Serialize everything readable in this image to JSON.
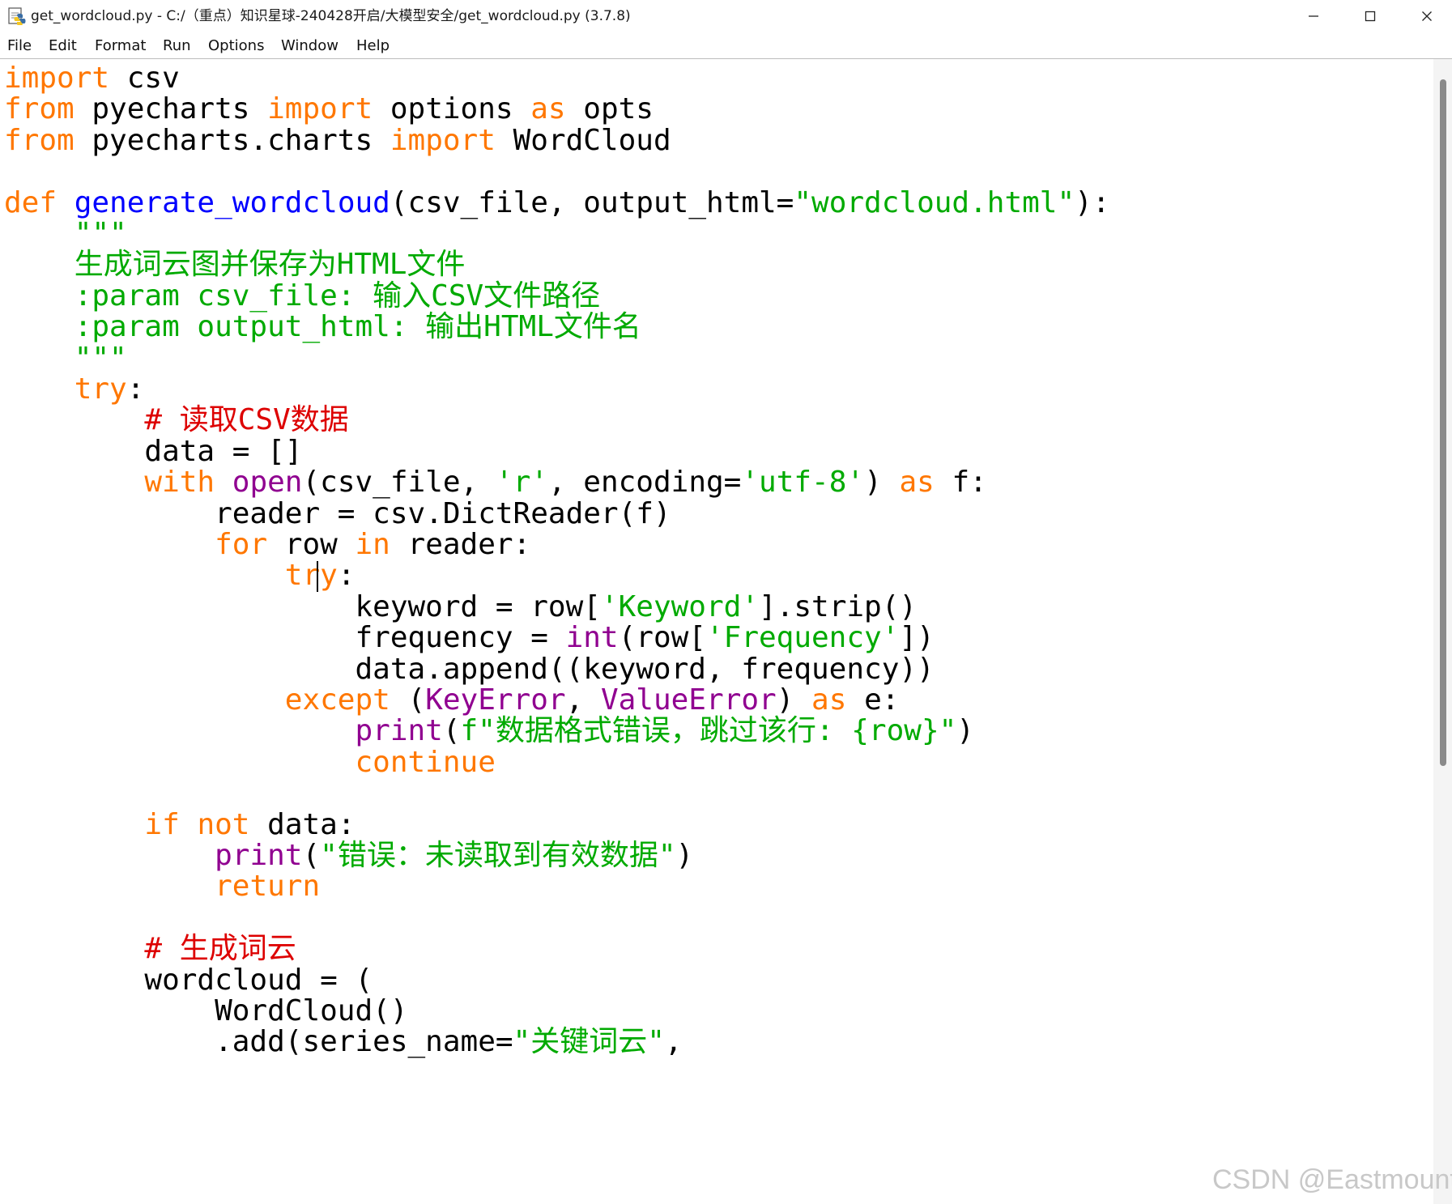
{
  "window": {
    "title": "get_wordcloud.py - C:/（重点）知识星球-240428开启/大模型安全/get_wordcloud.py (3.7.8)",
    "app_icon": "python-idle-icon",
    "controls": {
      "minimize": "─",
      "maximize": "☐",
      "close": "✕"
    }
  },
  "menu": {
    "items": [
      "File",
      "Edit",
      "Format",
      "Run",
      "Options",
      "Window",
      "Help"
    ]
  },
  "colors": {
    "keyword": "#ff7700",
    "builtin": "#900090",
    "string": "#00aa00",
    "comment": "#dd0000",
    "definition": "#0000ff",
    "text": "#000000"
  },
  "editor": {
    "lines": [
      [
        [
          "kw",
          "import"
        ],
        [
          "tx",
          " csv"
        ]
      ],
      [
        [
          "kw",
          "from"
        ],
        [
          "tx",
          " pyecharts "
        ],
        [
          "kw",
          "import"
        ],
        [
          "tx",
          " options "
        ],
        [
          "kw",
          "as"
        ],
        [
          "tx",
          " opts"
        ]
      ],
      [
        [
          "kw",
          "from"
        ],
        [
          "tx",
          " pyecharts.charts "
        ],
        [
          "kw",
          "import"
        ],
        [
          "tx",
          " WordCloud"
        ]
      ],
      [],
      [
        [
          "kw",
          "def"
        ],
        [
          "tx",
          " "
        ],
        [
          "df",
          "generate_wordcloud"
        ],
        [
          "tx",
          "(csv_file, output_html="
        ],
        [
          "st",
          "\"wordcloud.html\""
        ],
        [
          "tx",
          "):"
        ]
      ],
      [
        [
          "tx",
          "    "
        ],
        [
          "st",
          "\"\"\""
        ]
      ],
      [
        [
          "st",
          "    生成词云图并保存为HTML文件"
        ]
      ],
      [
        [
          "st",
          "    :param csv_file: 输入CSV文件路径"
        ]
      ],
      [
        [
          "st",
          "    :param output_html: 输出HTML文件名"
        ]
      ],
      [
        [
          "st",
          "    \"\"\""
        ]
      ],
      [
        [
          "tx",
          "    "
        ],
        [
          "kw",
          "try"
        ],
        [
          "tx",
          ":"
        ]
      ],
      [
        [
          "tx",
          "        "
        ],
        [
          "cm",
          "# 读取CSV数据"
        ]
      ],
      [
        [
          "tx",
          "        data = []"
        ]
      ],
      [
        [
          "tx",
          "        "
        ],
        [
          "kw",
          "with"
        ],
        [
          "tx",
          " "
        ],
        [
          "bi",
          "open"
        ],
        [
          "tx",
          "(csv_file, "
        ],
        [
          "st",
          "'r'"
        ],
        [
          "tx",
          ", encoding="
        ],
        [
          "st",
          "'utf-8'"
        ],
        [
          "tx",
          ") "
        ],
        [
          "kw",
          "as"
        ],
        [
          "tx",
          " f:"
        ]
      ],
      [
        [
          "tx",
          "            reader = csv.DictReader(f)"
        ]
      ],
      [
        [
          "tx",
          "            "
        ],
        [
          "kw",
          "for"
        ],
        [
          "tx",
          " row "
        ],
        [
          "kw",
          "in"
        ],
        [
          "tx",
          " reader:"
        ]
      ],
      [
        [
          "tx",
          "                "
        ],
        [
          "kw",
          "try"
        ],
        [
          "tx",
          ":"
        ]
      ],
      [
        [
          "tx",
          "                    keyword = row["
        ],
        [
          "st",
          "'Keyword'"
        ],
        [
          "tx",
          "].strip()"
        ]
      ],
      [
        [
          "tx",
          "                    frequency = "
        ],
        [
          "bi",
          "int"
        ],
        [
          "tx",
          "(row["
        ],
        [
          "st",
          "'Frequency'"
        ],
        [
          "tx",
          "])"
        ]
      ],
      [
        [
          "tx",
          "                    data.append((keyword, frequency))"
        ]
      ],
      [
        [
          "tx",
          "                "
        ],
        [
          "kw",
          "except"
        ],
        [
          "tx",
          " ("
        ],
        [
          "bi",
          "KeyError"
        ],
        [
          "tx",
          ", "
        ],
        [
          "bi",
          "ValueError"
        ],
        [
          "tx",
          ") "
        ],
        [
          "kw",
          "as"
        ],
        [
          "tx",
          " e:"
        ]
      ],
      [
        [
          "tx",
          "                    "
        ],
        [
          "bi",
          "print"
        ],
        [
          "tx",
          "("
        ],
        [
          "st",
          "f\"数据格式错误，跳过该行: {row}\""
        ],
        [
          "tx",
          ")"
        ]
      ],
      [
        [
          "tx",
          "                    "
        ],
        [
          "kw",
          "continue"
        ]
      ],
      [],
      [
        [
          "tx",
          "        "
        ],
        [
          "kw",
          "if"
        ],
        [
          "tx",
          " "
        ],
        [
          "kw",
          "not"
        ],
        [
          "tx",
          " data:"
        ]
      ],
      [
        [
          "tx",
          "            "
        ],
        [
          "bi",
          "print"
        ],
        [
          "tx",
          "("
        ],
        [
          "st",
          "\"错误：未读取到有效数据\""
        ],
        [
          "tx",
          ")"
        ]
      ],
      [
        [
          "tx",
          "            "
        ],
        [
          "kw",
          "return"
        ]
      ],
      [],
      [
        [
          "tx",
          "        "
        ],
        [
          "cm",
          "# 生成词云"
        ]
      ],
      [
        [
          "tx",
          "        wordcloud = ("
        ]
      ],
      [
        [
          "tx",
          "            WordCloud()"
        ]
      ],
      [
        [
          "tx",
          "            .add(series_name="
        ],
        [
          "st",
          "\"关键词云\""
        ],
        [
          "tx",
          ","
        ]
      ]
    ],
    "caret": {
      "line": 16,
      "column": 20
    }
  },
  "scrollbar": {
    "thumb_fraction": 0.6
  },
  "watermark": "CSDN @Eastmount"
}
